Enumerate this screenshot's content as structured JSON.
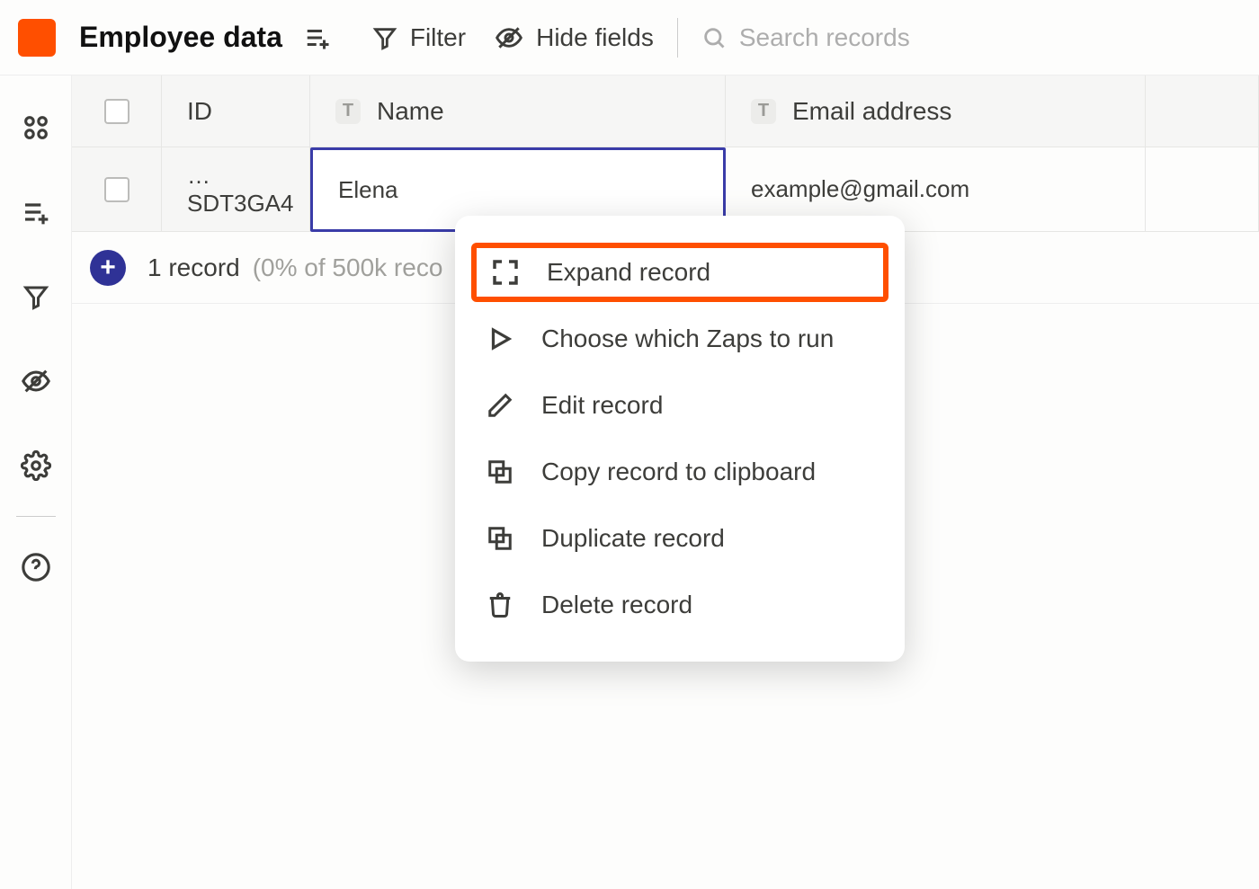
{
  "header": {
    "table_name": "Employee data",
    "filter_label": "Filter",
    "hide_fields_label": "Hide fields",
    "search_placeholder": "Search records"
  },
  "columns": {
    "id": "ID",
    "name": "Name",
    "email": "Email address"
  },
  "row": {
    "id": "…SDT3GA4",
    "name": "Elena",
    "email": "example@gmail.com"
  },
  "footer": {
    "count_label": "1 record",
    "quota_label": "(0% of 500k reco"
  },
  "context_menu": {
    "expand": "Expand record",
    "choose_zaps": "Choose which Zaps to run",
    "edit": "Edit record",
    "copy": "Copy record to clipboard",
    "duplicate": "Duplicate record",
    "delete": "Delete record"
  }
}
